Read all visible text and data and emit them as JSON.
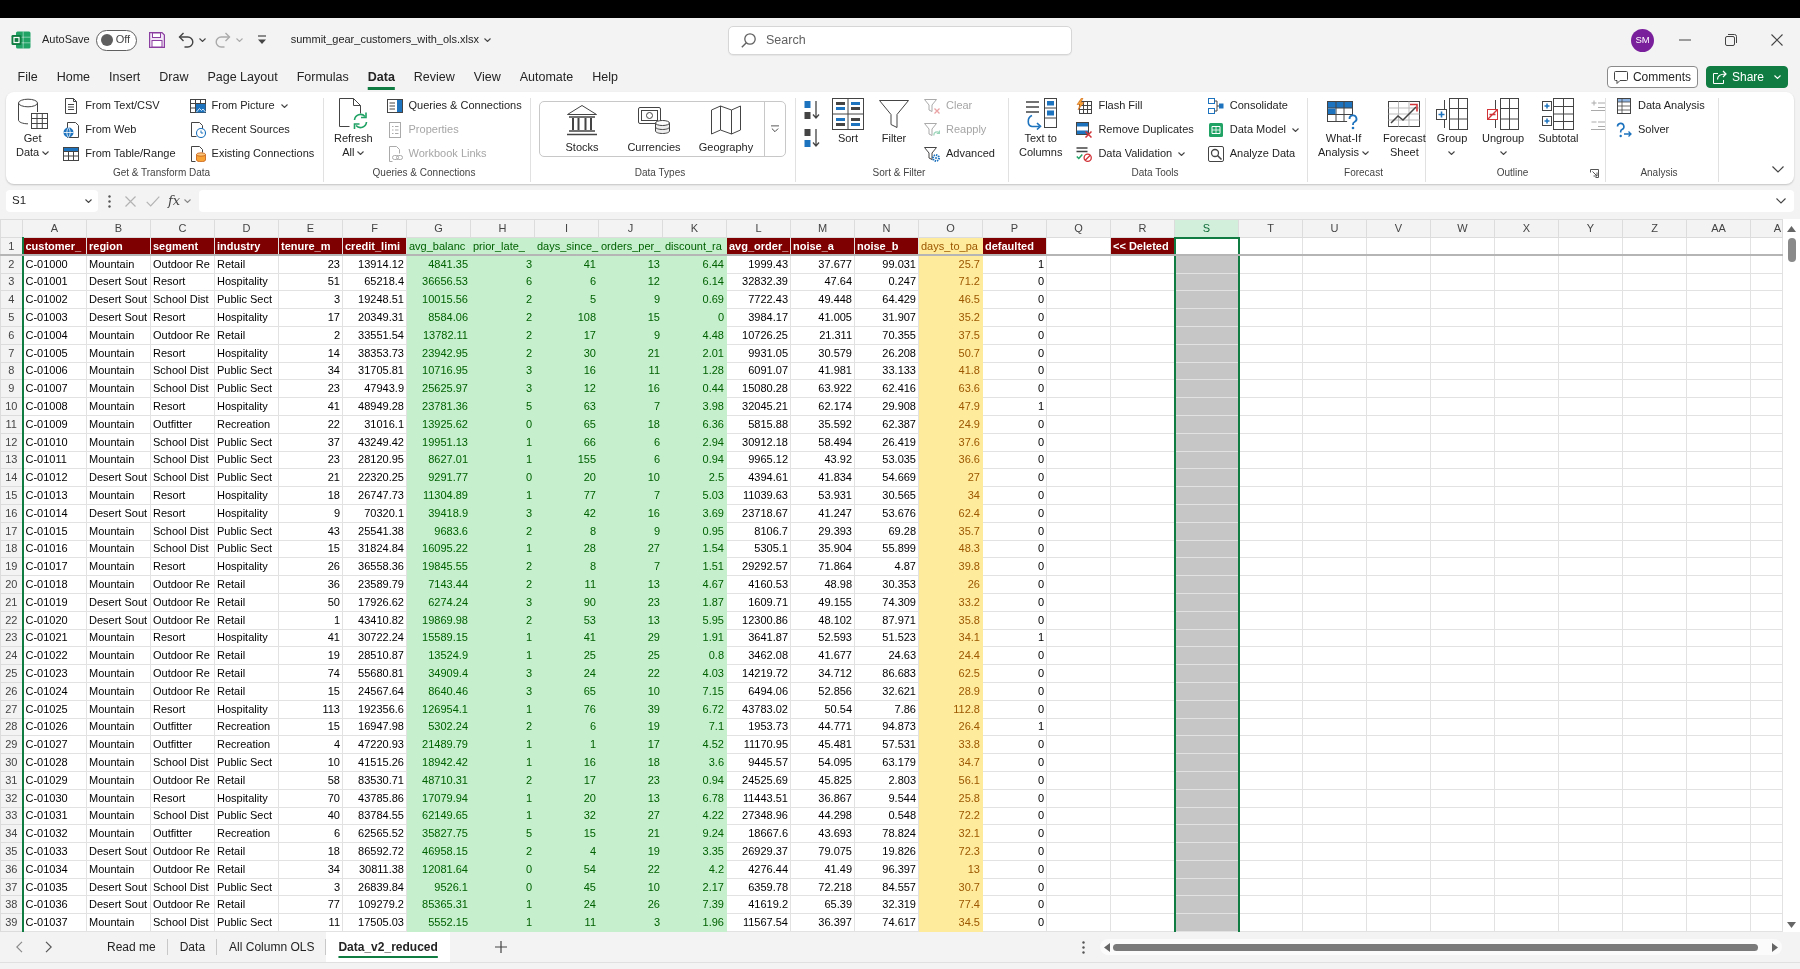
{
  "title_bar": {
    "autosave": {
      "label": "AutoSave",
      "toggle_text": "Off",
      "on": false
    },
    "file_name": "summit_gear_customers_with_ols.xlsx",
    "search": {
      "placeholder": "Search"
    },
    "avatar": "SM"
  },
  "menu_tabs": [
    {
      "label": "File",
      "selected": false
    },
    {
      "label": "Home",
      "selected": false
    },
    {
      "label": "Insert",
      "selected": false
    },
    {
      "label": "Draw",
      "selected": false
    },
    {
      "label": "Page Layout",
      "selected": false
    },
    {
      "label": "Formulas",
      "selected": false
    },
    {
      "label": "Data",
      "selected": true
    },
    {
      "label": "Review",
      "selected": false
    },
    {
      "label": "View",
      "selected": false
    },
    {
      "label": "Automate",
      "selected": false
    },
    {
      "label": "Help",
      "selected": false
    }
  ],
  "actions": [
    {
      "label": "Comments",
      "kind": "outline"
    },
    {
      "label": "Share",
      "kind": "primary",
      "dropdown": true
    }
  ],
  "ribbon": {
    "groups": [
      {
        "label": "Get & Transform Data",
        "items": [
          {
            "kind": "large",
            "lines": [
              "Get",
              "Data"
            ],
            "dropdown": true,
            "disabled": false
          },
          {
            "kind": "small",
            "label": "From Text/CSV",
            "disabled": false
          },
          {
            "kind": "small",
            "label": "From Web",
            "disabled": false
          },
          {
            "kind": "small",
            "label": "From Table/Range",
            "disabled": false
          },
          {
            "kind": "small",
            "label": "From Picture",
            "dropdown": true,
            "disabled": false
          },
          {
            "kind": "small",
            "label": "Recent Sources",
            "disabled": false
          },
          {
            "kind": "small",
            "label": "Existing Connections",
            "disabled": false
          }
        ]
      },
      {
        "label": "Queries & Connections",
        "items": [
          {
            "kind": "large",
            "lines": [
              "Refresh",
              "All"
            ],
            "dropdown": true,
            "disabled": false
          },
          {
            "kind": "small",
            "label": "Queries & Connections",
            "disabled": false
          },
          {
            "kind": "small",
            "label": "Properties",
            "disabled": true
          },
          {
            "kind": "small",
            "label": "Workbook Links",
            "disabled": true
          }
        ]
      },
      {
        "label": "Data Types",
        "items": [
          {
            "kind": "gallery",
            "label": "Stocks",
            "disabled": false
          },
          {
            "kind": "gallery",
            "label": "Currencies",
            "disabled": false
          },
          {
            "kind": "gallery",
            "label": "Geography",
            "disabled": false
          }
        ]
      },
      {
        "label": "Sort & Filter",
        "items": [
          {
            "kind": "icon",
            "disabled": false
          },
          {
            "kind": "icon",
            "disabled": false
          },
          {
            "kind": "large",
            "lines": [
              "Sort"
            ],
            "disabled": false
          },
          {
            "kind": "large",
            "lines": [
              "Filter"
            ],
            "disabled": false
          },
          {
            "kind": "small",
            "label": "Clear",
            "disabled": true
          },
          {
            "kind": "small",
            "label": "Reapply",
            "disabled": true
          },
          {
            "kind": "small",
            "label": "Advanced",
            "disabled": false
          }
        ]
      },
      {
        "label": "Data Tools",
        "items": [
          {
            "kind": "large",
            "lines": [
              "Text to",
              "Columns"
            ],
            "disabled": false
          },
          {
            "kind": "small",
            "label": "Flash Fill",
            "disabled": false
          },
          {
            "kind": "small",
            "label": "Remove Duplicates",
            "disabled": false
          },
          {
            "kind": "small",
            "label": "Data Validation",
            "dropdown": true,
            "disabled": false
          },
          {
            "kind": "small",
            "label": "Consolidate",
            "disabled": false
          },
          {
            "kind": "small",
            "label": "Data Model",
            "dropdown": true,
            "disabled": false
          },
          {
            "kind": "small",
            "label": "Analyze Data",
            "disabled": false
          }
        ]
      },
      {
        "label": "Forecast",
        "items": [
          {
            "kind": "large",
            "lines": [
              "What-If",
              "Analysis"
            ],
            "dropdown": true,
            "disabled": false
          },
          {
            "kind": "large",
            "lines": [
              "Forecast",
              "Sheet"
            ],
            "disabled": false
          }
        ]
      },
      {
        "label": "Outline",
        "launcher": true,
        "items": [
          {
            "kind": "large",
            "lines": [
              "Group"
            ],
            "dropdown": true,
            "disabled": false
          },
          {
            "kind": "large",
            "lines": [
              "Ungroup"
            ],
            "dropdown": true,
            "disabled": false
          },
          {
            "kind": "large",
            "lines": [
              "Subtotal"
            ],
            "disabled": false
          },
          {
            "kind": "icon",
            "disabled": true
          },
          {
            "kind": "icon",
            "disabled": true
          }
        ]
      },
      {
        "label": "Analysis",
        "items": [
          {
            "kind": "small",
            "label": "Data Analysis",
            "disabled": false
          },
          {
            "kind": "small",
            "label": "Solver",
            "disabled": false
          }
        ]
      }
    ]
  },
  "formula_bar": {
    "name_box": "S1",
    "function_button": "fx"
  },
  "sheet": {
    "columns": [
      {
        "label": "A",
        "kind": "text",
        "selected": false
      },
      {
        "label": "B",
        "kind": "text",
        "selected": false
      },
      {
        "label": "C",
        "kind": "text",
        "selected": false
      },
      {
        "label": "D",
        "kind": "text",
        "selected": false
      },
      {
        "label": "E",
        "kind": "number",
        "selected": false
      },
      {
        "label": "F",
        "kind": "number",
        "selected": false
      },
      {
        "label": "G",
        "kind": "good",
        "selected": false
      },
      {
        "label": "H",
        "kind": "good",
        "selected": false
      },
      {
        "label": "I",
        "kind": "good",
        "selected": false
      },
      {
        "label": "J",
        "kind": "good",
        "selected": false
      },
      {
        "label": "K",
        "kind": "good",
        "selected": false
      },
      {
        "label": "L",
        "kind": "number",
        "selected": false
      },
      {
        "label": "M",
        "kind": "number",
        "selected": false
      },
      {
        "label": "N",
        "kind": "number",
        "selected": false
      },
      {
        "label": "O",
        "kind": "neutral",
        "selected": false
      },
      {
        "label": "P",
        "kind": "number",
        "selected": false
      },
      {
        "label": "Q",
        "selected": false
      },
      {
        "label": "R",
        "selected": false
      },
      {
        "label": "S",
        "selected": true
      },
      {
        "label": "T",
        "selected": false
      },
      {
        "label": "U",
        "selected": false
      },
      {
        "label": "V",
        "selected": false
      },
      {
        "label": "W",
        "selected": false
      },
      {
        "label": "X",
        "selected": false
      },
      {
        "label": "Y",
        "selected": false
      },
      {
        "label": "Z",
        "selected": false
      },
      {
        "label": "AA",
        "selected": false
      },
      {
        "label": "A",
        "selected": false
      }
    ],
    "header_row": {
      "number": "1",
      "cells": [
        {
          "text": "customer_",
          "kind": "title"
        },
        {
          "text": "region",
          "kind": "title"
        },
        {
          "text": "segment",
          "kind": "title"
        },
        {
          "text": "industry",
          "kind": "title"
        },
        {
          "text": "tenure_m",
          "kind": "title"
        },
        {
          "text": "credit_limi",
          "kind": "title"
        },
        {
          "text": "avg_balanc",
          "kind": "good"
        },
        {
          "text": "prior_late_",
          "kind": "good"
        },
        {
          "text": "days_since_",
          "kind": "good"
        },
        {
          "text": "orders_per_",
          "kind": "good"
        },
        {
          "text": "discount_ra",
          "kind": "good"
        },
        {
          "text": "avg_order_",
          "kind": "title"
        },
        {
          "text": "noise_a",
          "kind": "title"
        },
        {
          "text": "noise_b",
          "kind": "title"
        },
        {
          "text": "days_to_pa",
          "kind": "neutral"
        },
        {
          "text": "defaulted",
          "kind": "title"
        },
        null,
        {
          "text": "<< Deleted",
          "kind": "title"
        }
      ]
    },
    "rows": [
      {
        "number": "2",
        "cells": [
          "C-01000",
          "Mountain",
          "Outdoor Re",
          "Retail",
          "23",
          "13914.12",
          "4841.35",
          "3",
          "41",
          "13",
          "6.44",
          "1999.43",
          "37.677",
          "99.031",
          "25.7",
          "1"
        ]
      },
      {
        "number": "3",
        "cells": [
          "C-01001",
          "Desert Sout",
          "Resort",
          "Hospitality",
          "51",
          "65218.4",
          "36656.53",
          "6",
          "6",
          "12",
          "6.14",
          "32832.39",
          "47.64",
          "0.247",
          "71.2",
          "0"
        ]
      },
      {
        "number": "4",
        "cells": [
          "C-01002",
          "Desert Sout",
          "School Dist",
          "Public Sect",
          "3",
          "19248.51",
          "10015.56",
          "2",
          "5",
          "9",
          "0.69",
          "7722.43",
          "49.448",
          "64.429",
          "46.5",
          "0"
        ]
      },
      {
        "number": "5",
        "cells": [
          "C-01003",
          "Desert Sout",
          "Resort",
          "Hospitality",
          "17",
          "20349.31",
          "8584.06",
          "2",
          "108",
          "15",
          "0",
          "3984.17",
          "41.005",
          "31.907",
          "35.2",
          "0"
        ]
      },
      {
        "number": "6",
        "cells": [
          "C-01004",
          "Mountain",
          "Outdoor Re",
          "Retail",
          "2",
          "33551.54",
          "13782.11",
          "2",
          "17",
          "9",
          "4.48",
          "10726.25",
          "21.311",
          "70.355",
          "37.5",
          "0"
        ]
      },
      {
        "number": "7",
        "cells": [
          "C-01005",
          "Mountain",
          "Resort",
          "Hospitality",
          "14",
          "38353.73",
          "23942.95",
          "2",
          "30",
          "21",
          "2.01",
          "9931.05",
          "30.579",
          "26.208",
          "50.7",
          "0"
        ]
      },
      {
        "number": "8",
        "cells": [
          "C-01006",
          "Mountain",
          "School Dist",
          "Public Sect",
          "34",
          "31705.81",
          "10716.95",
          "3",
          "16",
          "11",
          "1.28",
          "6091.07",
          "41.981",
          "33.133",
          "41.8",
          "0"
        ]
      },
      {
        "number": "9",
        "cells": [
          "C-01007",
          "Mountain",
          "School Dist",
          "Public Sect",
          "23",
          "47943.9",
          "25625.97",
          "3",
          "12",
          "16",
          "0.44",
          "15080.28",
          "63.922",
          "62.416",
          "63.6",
          "0"
        ]
      },
      {
        "number": "10",
        "cells": [
          "C-01008",
          "Mountain",
          "Resort",
          "Hospitality",
          "41",
          "48949.28",
          "23781.36",
          "5",
          "63",
          "7",
          "3.98",
          "32045.21",
          "62.174",
          "29.908",
          "47.9",
          "1"
        ]
      },
      {
        "number": "11",
        "cells": [
          "C-01009",
          "Mountain",
          "Outfitter",
          "Recreation",
          "22",
          "31016.1",
          "13925.62",
          "0",
          "65",
          "18",
          "6.36",
          "5815.88",
          "35.592",
          "62.387",
          "24.9",
          "0"
        ]
      },
      {
        "number": "12",
        "cells": [
          "C-01010",
          "Mountain",
          "School Dist",
          "Public Sect",
          "37",
          "43249.42",
          "19951.13",
          "1",
          "66",
          "6",
          "2.94",
          "30912.18",
          "58.494",
          "26.419",
          "37.6",
          "0"
        ]
      },
      {
        "number": "13",
        "cells": [
          "C-01011",
          "Mountain",
          "School Dist",
          "Public Sect",
          "23",
          "28120.95",
          "8627.01",
          "1",
          "155",
          "6",
          "0.94",
          "9965.12",
          "43.92",
          "53.035",
          "36.6",
          "0"
        ]
      },
      {
        "number": "14",
        "cells": [
          "C-01012",
          "Desert Sout",
          "School Dist",
          "Public Sect",
          "21",
          "22320.25",
          "9291.77",
          "0",
          "20",
          "10",
          "2.5",
          "4394.61",
          "41.834",
          "54.669",
          "27",
          "0"
        ]
      },
      {
        "number": "15",
        "cells": [
          "C-01013",
          "Mountain",
          "Resort",
          "Hospitality",
          "18",
          "26747.73",
          "11304.89",
          "1",
          "77",
          "7",
          "5.03",
          "11039.63",
          "53.931",
          "30.565",
          "34",
          "0"
        ]
      },
      {
        "number": "16",
        "cells": [
          "C-01014",
          "Desert Sout",
          "Resort",
          "Hospitality",
          "9",
          "70320.1",
          "39418.9",
          "3",
          "42",
          "16",
          "3.69",
          "23718.67",
          "41.247",
          "53.676",
          "62.4",
          "0"
        ]
      },
      {
        "number": "17",
        "cells": [
          "C-01015",
          "Mountain",
          "School Dist",
          "Public Sect",
          "43",
          "25541.38",
          "9683.6",
          "2",
          "8",
          "9",
          "0.95",
          "8106.7",
          "29.393",
          "69.28",
          "35.7",
          "0"
        ]
      },
      {
        "number": "18",
        "cells": [
          "C-01016",
          "Mountain",
          "School Dist",
          "Public Sect",
          "15",
          "31824.84",
          "16095.22",
          "1",
          "28",
          "27",
          "1.54",
          "5305.1",
          "35.904",
          "55.899",
          "48.3",
          "0"
        ]
      },
      {
        "number": "19",
        "cells": [
          "C-01017",
          "Mountain",
          "Resort",
          "Hospitality",
          "26",
          "36558.36",
          "19845.55",
          "2",
          "8",
          "7",
          "1.51",
          "29292.57",
          "71.864",
          "4.87",
          "39.8",
          "0"
        ]
      },
      {
        "number": "20",
        "cells": [
          "C-01018",
          "Mountain",
          "Outdoor Re",
          "Retail",
          "36",
          "23589.79",
          "7143.44",
          "2",
          "11",
          "13",
          "4.67",
          "4160.53",
          "48.98",
          "30.353",
          "26",
          "0"
        ]
      },
      {
        "number": "21",
        "cells": [
          "C-01019",
          "Desert Sout",
          "Outdoor Re",
          "Retail",
          "50",
          "17926.62",
          "6274.24",
          "3",
          "90",
          "23",
          "1.87",
          "1609.71",
          "49.155",
          "74.309",
          "33.2",
          "0"
        ]
      },
      {
        "number": "22",
        "cells": [
          "C-01020",
          "Desert Sout",
          "Outdoor Re",
          "Retail",
          "1",
          "43410.82",
          "19869.98",
          "2",
          "53",
          "13",
          "5.95",
          "12300.86",
          "48.102",
          "87.971",
          "35.8",
          "0"
        ]
      },
      {
        "number": "23",
        "cells": [
          "C-01021",
          "Mountain",
          "Resort",
          "Hospitality",
          "41",
          "30722.24",
          "15589.15",
          "1",
          "41",
          "29",
          "1.91",
          "3641.87",
          "52.593",
          "51.523",
          "34.1",
          "1"
        ]
      },
      {
        "number": "24",
        "cells": [
          "C-01022",
          "Mountain",
          "Outdoor Re",
          "Retail",
          "19",
          "28510.87",
          "13524.9",
          "1",
          "25",
          "25",
          "0.8",
          "3462.08",
          "41.677",
          "24.63",
          "24.4",
          "0"
        ]
      },
      {
        "number": "25",
        "cells": [
          "C-01023",
          "Mountain",
          "Outdoor Re",
          "Retail",
          "74",
          "55680.81",
          "34909.4",
          "3",
          "24",
          "22",
          "4.03",
          "14219.72",
          "34.712",
          "86.683",
          "62.5",
          "0"
        ]
      },
      {
        "number": "26",
        "cells": [
          "C-01024",
          "Mountain",
          "Outdoor Re",
          "Retail",
          "15",
          "24567.64",
          "8640.46",
          "3",
          "65",
          "10",
          "7.15",
          "6494.06",
          "52.856",
          "32.621",
          "28.9",
          "0"
        ]
      },
      {
        "number": "27",
        "cells": [
          "C-01025",
          "Mountain",
          "Resort",
          "Hospitality",
          "113",
          "192356.6",
          "126954.1",
          "1",
          "76",
          "39",
          "6.72",
          "43783.02",
          "50.54",
          "7.86",
          "112.8",
          "0"
        ]
      },
      {
        "number": "28",
        "cells": [
          "C-01026",
          "Mountain",
          "Outfitter",
          "Recreation",
          "15",
          "16947.98",
          "5302.24",
          "2",
          "6",
          "19",
          "7.1",
          "1953.73",
          "44.771",
          "94.873",
          "26.4",
          "1"
        ]
      },
      {
        "number": "29",
        "cells": [
          "C-01027",
          "Mountain",
          "Outfitter",
          "Recreation",
          "4",
          "47220.93",
          "21489.79",
          "1",
          "1",
          "17",
          "4.52",
          "11170.95",
          "45.481",
          "57.531",
          "33.8",
          "0"
        ]
      },
      {
        "number": "30",
        "cells": [
          "C-01028",
          "Mountain",
          "School Dist",
          "Public Sect",
          "10",
          "41515.26",
          "18942.42",
          "1",
          "16",
          "18",
          "3.6",
          "9445.57",
          "54.095",
          "63.179",
          "34.7",
          "0"
        ]
      },
      {
        "number": "31",
        "cells": [
          "C-01029",
          "Mountain",
          "Outdoor Re",
          "Retail",
          "58",
          "83530.71",
          "48710.31",
          "2",
          "17",
          "23",
          "0.94",
          "24525.69",
          "45.825",
          "2.803",
          "56.1",
          "0"
        ]
      },
      {
        "number": "32",
        "cells": [
          "C-01030",
          "Mountain",
          "Resort",
          "Hospitality",
          "70",
          "43785.86",
          "17079.94",
          "1",
          "20",
          "13",
          "6.78",
          "11443.51",
          "36.867",
          "9.544",
          "25.8",
          "0"
        ]
      },
      {
        "number": "33",
        "cells": [
          "C-01031",
          "Mountain",
          "School Dist",
          "Public Sect",
          "40",
          "83784.55",
          "62149.65",
          "1",
          "32",
          "27",
          "4.22",
          "27348.96",
          "44.298",
          "0.548",
          "72.2",
          "0"
        ]
      },
      {
        "number": "34",
        "cells": [
          "C-01032",
          "Mountain",
          "Outfitter",
          "Recreation",
          "6",
          "62565.52",
          "35827.75",
          "5",
          "15",
          "21",
          "9.24",
          "18667.6",
          "43.693",
          "78.824",
          "32.1",
          "0"
        ]
      },
      {
        "number": "35",
        "cells": [
          "C-01033",
          "Desert Sout",
          "Outdoor Re",
          "Retail",
          "18",
          "86592.72",
          "46958.15",
          "2",
          "4",
          "19",
          "3.35",
          "26929.37",
          "79.075",
          "19.826",
          "72.3",
          "0"
        ]
      },
      {
        "number": "36",
        "cells": [
          "C-01034",
          "Mountain",
          "Outdoor Re",
          "Retail",
          "34",
          "30811.38",
          "12081.64",
          "0",
          "54",
          "22",
          "4.2",
          "4276.44",
          "41.49",
          "96.397",
          "13",
          "0"
        ]
      },
      {
        "number": "37",
        "cells": [
          "C-01035",
          "Desert Sout",
          "School Dist",
          "Public Sect",
          "3",
          "26839.84",
          "9526.1",
          "0",
          "45",
          "10",
          "2.17",
          "6359.78",
          "72.218",
          "84.557",
          "30.7",
          "0"
        ]
      },
      {
        "number": "38",
        "cells": [
          "C-01036",
          "Desert Sout",
          "Outdoor Re",
          "Retail",
          "77",
          "109279.2",
          "85365.31",
          "1",
          "24",
          "26",
          "7.39",
          "41619.2",
          "65.39",
          "32.319",
          "77.4",
          "0"
        ]
      },
      {
        "number": "39",
        "cells": [
          "C-01037",
          "Mountain",
          "School Dist",
          "Public Sect",
          "11",
          "17505.03",
          "5552.15",
          "1",
          "11",
          "3",
          "1.96",
          "11567.54",
          "36.397",
          "74.617",
          "34.5",
          "0"
        ]
      }
    ]
  },
  "sheet_tabs": [
    {
      "label": "Read me",
      "selected": false
    },
    {
      "label": "Data",
      "selected": false
    },
    {
      "label": "All Column OLS",
      "selected": false
    },
    {
      "label": "Data_v2_reduced",
      "selected": true
    }
  ]
}
